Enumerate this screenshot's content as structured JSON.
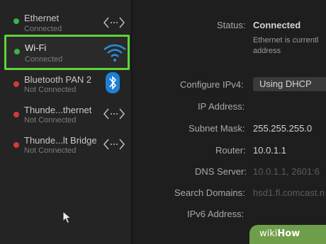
{
  "sidebar": {
    "services": [
      {
        "name": "Ethernet",
        "status": "Connected",
        "dot": "#3bb34a",
        "icon": "ethernet-arrows-icon"
      },
      {
        "name": "Wi-Fi",
        "status": "Connected",
        "dot": "#3bb34a",
        "icon": "wifi-icon",
        "selected": true
      },
      {
        "name": "Bluetooth PAN 2",
        "status": "Not Connected",
        "dot": "#d23b3b",
        "icon": "bluetooth-icon"
      },
      {
        "name": "Thunde...thernet",
        "status": "Not Connected",
        "dot": "#d23b3b",
        "icon": "ethernet-arrows-icon"
      },
      {
        "name": "Thunde...lt Bridge",
        "status": "Not Connected",
        "dot": "#d23b3b",
        "icon": "ethernet-arrows-icon"
      }
    ]
  },
  "detail": {
    "status_label": "Status:",
    "status_value": "Connected",
    "status_desc_line1": "Ethernet is currentl",
    "status_desc_line2": "address",
    "configure_label": "Configure IPv4:",
    "configure_value": "Using DHCP",
    "ip_label": "IP Address:",
    "subnet_label": "Subnet Mask:",
    "subnet_value": "255.255.255.0",
    "router_label": "Router:",
    "router_value": "10.0.1.1",
    "dns_label": "DNS Server:",
    "dns_value": "10.0.1.1, 2601:6",
    "search_label": "Search Domains:",
    "search_value": "hsd1.fl.comcast.n",
    "ipv6_label": "IPv6 Address:"
  },
  "watermark": {
    "wiki": "wiki",
    "how": "How"
  },
  "colors": {
    "selection": "#5fd33a",
    "connected": "#3bb34a",
    "disconnected": "#d23b3b",
    "accent": "#1e7fd6"
  }
}
